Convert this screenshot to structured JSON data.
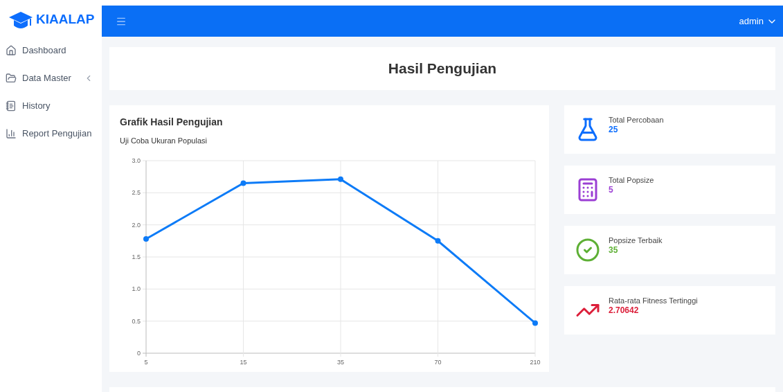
{
  "brand": "KIAALAP",
  "sidebar": {
    "items": [
      {
        "label": "Dashboard",
        "kind": "home"
      },
      {
        "label": "Data Master",
        "kind": "folder-group"
      },
      {
        "label": "History",
        "kind": "note"
      },
      {
        "label": "Report Pengujian",
        "kind": "chart"
      }
    ]
  },
  "topbar": {
    "user": "admin"
  },
  "page_title": "Hasil Pengujian",
  "chart_card": {
    "title": "Grafik Hasil Pengujian",
    "chart_data": {
      "type": "line",
      "title": "Uji Coba Ukuran Populasi",
      "categories": [
        "5",
        "15",
        "35",
        "70",
        "210"
      ],
      "series": [
        {
          "color": "#0d7bf7",
          "marker": true,
          "values": [
            1.78,
            2.65,
            2.71,
            1.75,
            0.47
          ]
        }
      ],
      "grid": true,
      "ylim": [
        0,
        3
      ],
      "yticks": [
        {
          "value": 0,
          "label": "0"
        },
        {
          "value": 0.5,
          "label": "0.5"
        },
        {
          "value": 1,
          "label": "1.0"
        },
        {
          "value": 1.5,
          "label": "1.5"
        },
        {
          "value": 2,
          "label": "2.0"
        },
        {
          "value": 2.5,
          "label": "2.5"
        },
        {
          "value": 3,
          "label": "3.0"
        }
      ]
    }
  },
  "stats": [
    {
      "label": "Total Percobaan",
      "value": "25",
      "kind": "flask",
      "color": "#0d6efd"
    },
    {
      "label": "Total Popsize",
      "value": "5",
      "kind": "calculator",
      "color": "#9b3fd4"
    },
    {
      "label": "Popsize Terbaik",
      "value": "35",
      "kind": "check",
      "color": "#5daf34"
    },
    {
      "label": "Rata-rata Fitness Tertinggi",
      "value": "2.70642",
      "kind": "trend",
      "color": "#dc1f3a"
    }
  ]
}
